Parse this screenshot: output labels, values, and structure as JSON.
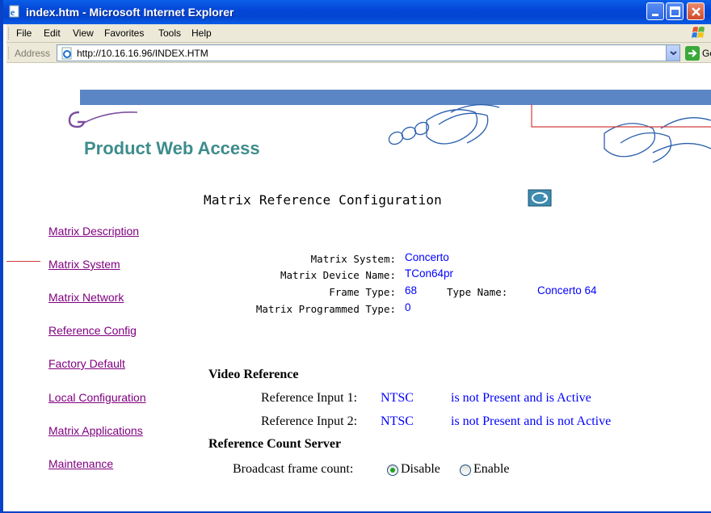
{
  "window": {
    "title": "index.htm - Microsoft Internet Explorer"
  },
  "menu": [
    "File",
    "Edit",
    "View",
    "Favorites",
    "Tools",
    "Help"
  ],
  "address": {
    "label": "Address",
    "url": "http://10.16.16.96/INDEX.HTM",
    "go_label": "Go"
  },
  "header": {
    "product_title": "Product Web Access"
  },
  "page": {
    "heading": "Matrix Reference Configuration"
  },
  "nav": {
    "items": [
      "Matrix Description",
      "Matrix System",
      "Matrix Network",
      "Reference Config",
      "Factory Default",
      "Local Configuration",
      "Matrix Applications",
      "Maintenance"
    ]
  },
  "matrix": {
    "system_label": "Matrix System:",
    "system_value": "Concerto",
    "device_label": "Matrix Device Name:",
    "device_value": "TCon64pr",
    "frame_label": "Frame Type:",
    "frame_value": "68",
    "type_name_label": "Type Name:",
    "type_name_value": "Concerto 64",
    "programmed_label": "Matrix Programmed Type:",
    "programmed_value": "0"
  },
  "video_reference": {
    "heading": "Video Reference",
    "inputs": [
      {
        "label": "Reference Input 1:",
        "standard": "NTSC",
        "status": "is not Present and is Active"
      },
      {
        "label": "Reference Input 2:",
        "standard": "NTSC",
        "status": "is not Present and is not Active"
      }
    ]
  },
  "count_server": {
    "heading": "Reference Count Server",
    "label": "Broadcast frame count:",
    "options": [
      "Disable",
      "Enable"
    ],
    "selected": "Disable"
  },
  "colors": {
    "title_bar": "#0447d8",
    "link": "#800080",
    "value": "#0000ff",
    "brand": "#3e8c8c",
    "band": "#5b86c5"
  }
}
